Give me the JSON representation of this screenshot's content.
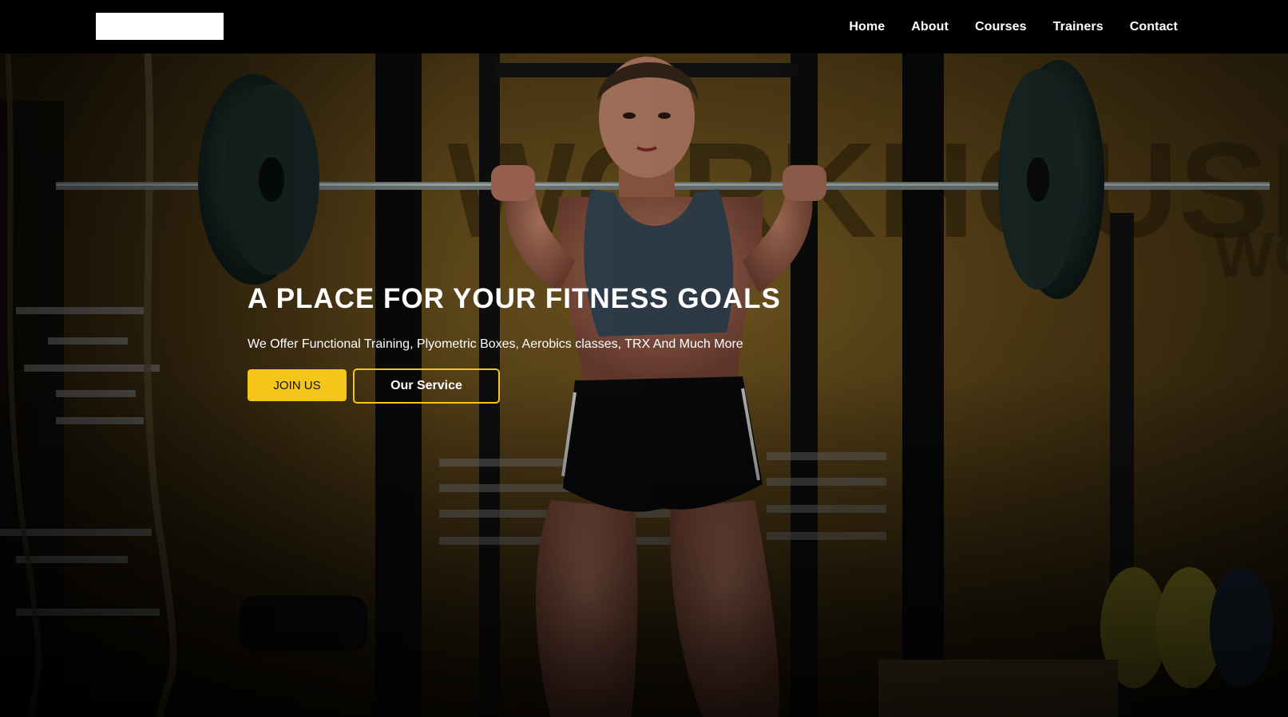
{
  "nav": {
    "links": [
      "Home",
      "About",
      "Courses",
      "Trainers",
      "Contact"
    ]
  },
  "hero": {
    "title": "A PLACE FOR YOUR FITNESS GOALS",
    "subtitle": "We Offer Functional Training, Plyometric Boxes, Aerobics classes, TRX And Much More",
    "join_label": "JOIN US",
    "service_label": "Our Service",
    "background_image": "gym-woman-lifting-barbell-photo"
  },
  "colors": {
    "accent": "#f5c518",
    "nav_bg": "#000000",
    "text": "#ffffff"
  }
}
